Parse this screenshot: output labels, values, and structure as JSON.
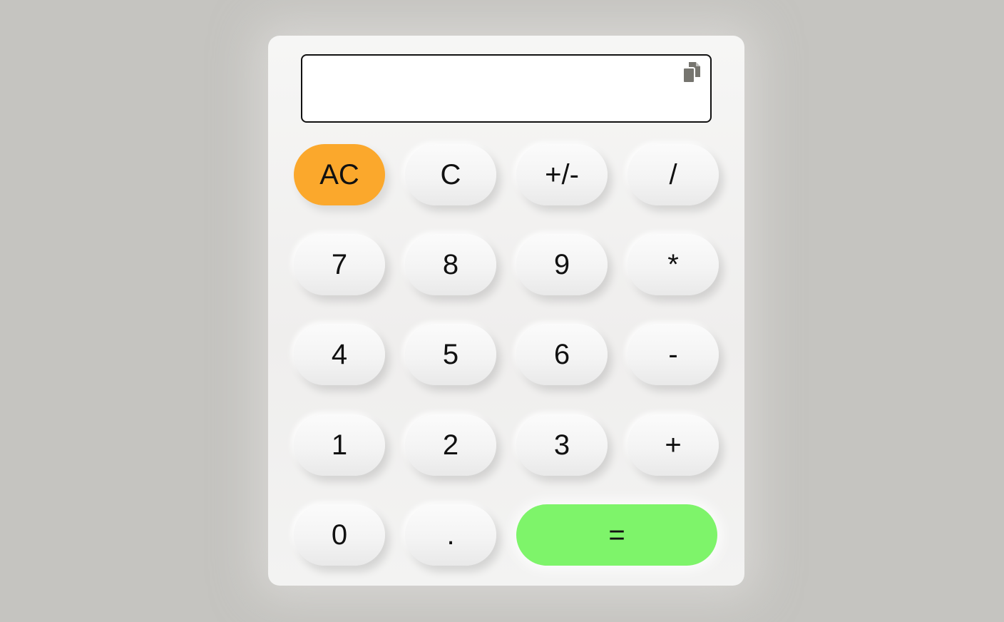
{
  "display": {
    "value": ""
  },
  "icons": {
    "copy": "copy-icon",
    "copy_color": "#76756f"
  },
  "colors": {
    "background": "#c5c4c0",
    "ac_button": "#fba82c",
    "equals_button": "#7ef46a"
  },
  "buttons": {
    "ac": "AC",
    "c": "C",
    "plus_minus": "+/-",
    "divide": "/",
    "seven": "7",
    "eight": "8",
    "nine": "9",
    "multiply": "*",
    "four": "4",
    "five": "5",
    "six": "6",
    "minus": "-",
    "one": "1",
    "two": "2",
    "three": "3",
    "plus": "+",
    "zero": "0",
    "decimal": ".",
    "equals": "="
  }
}
